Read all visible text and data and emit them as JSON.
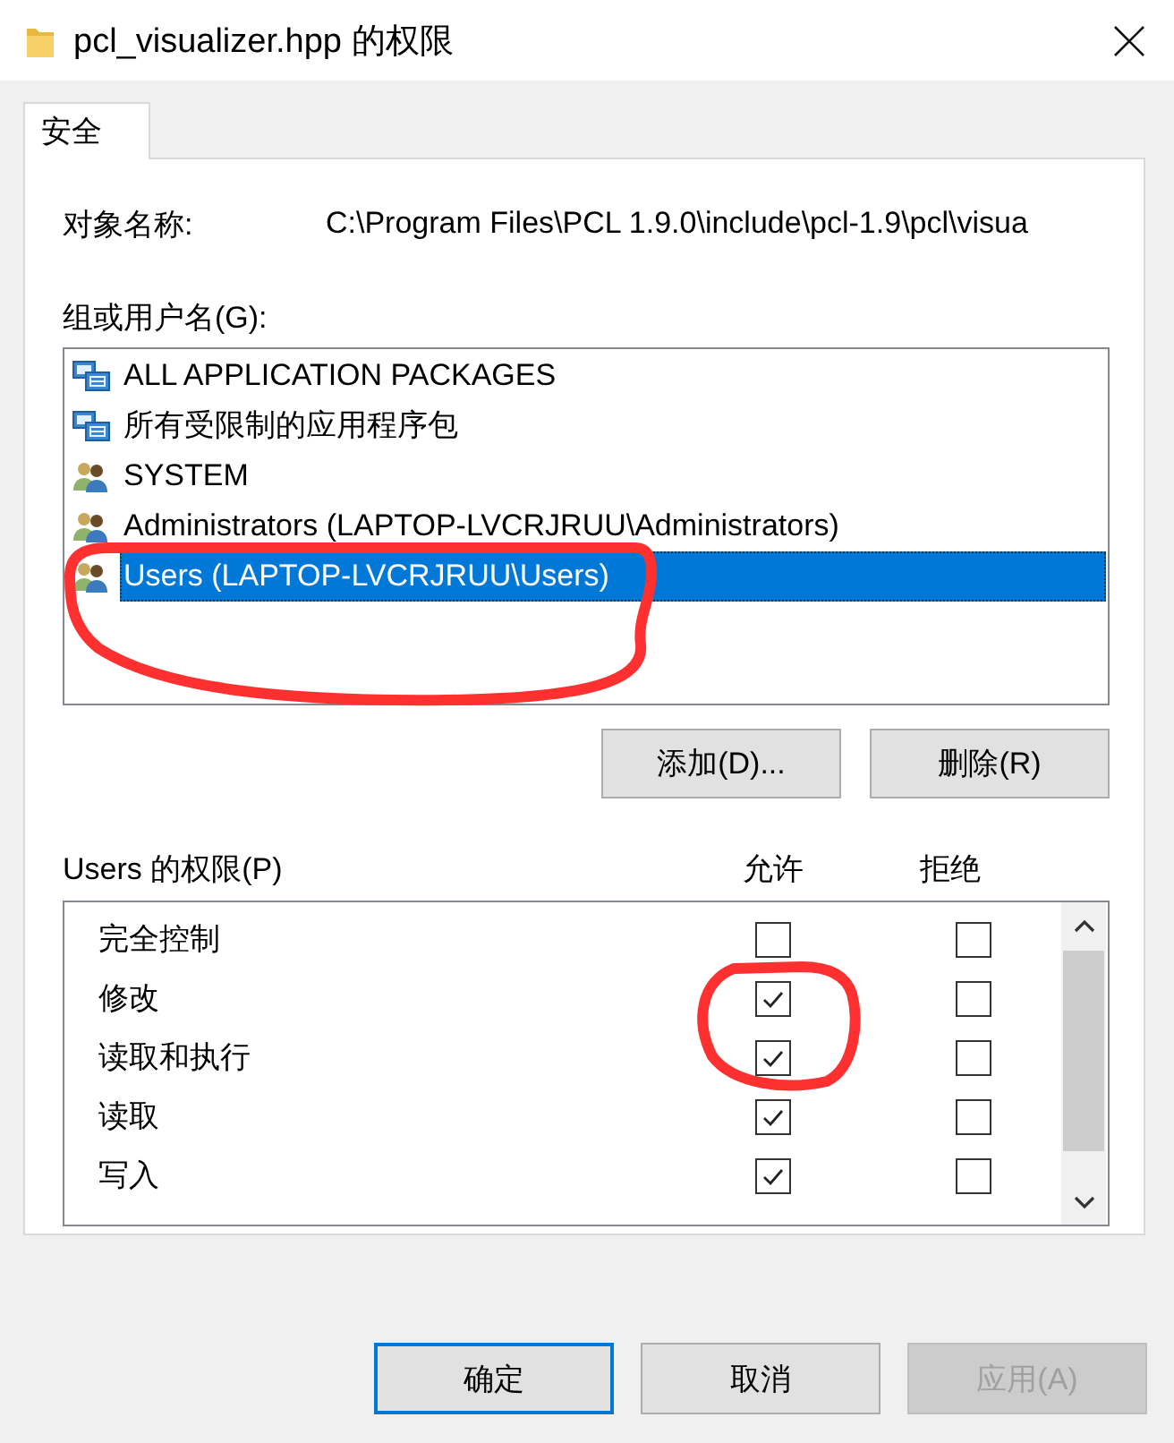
{
  "window": {
    "title": "pcl_visualizer.hpp 的权限"
  },
  "tabs": [
    {
      "label": "安全",
      "selected": true
    }
  ],
  "object_name": {
    "label": "对象名称:",
    "value": "C:\\Program Files\\PCL 1.9.0\\include\\pcl-1.9\\pcl\\visua"
  },
  "groups": {
    "label": "组或用户名(G):",
    "items": [
      {
        "name": "ALL APPLICATION PACKAGES",
        "kind": "package",
        "selected": false
      },
      {
        "name": "所有受限制的应用程序包",
        "kind": "package",
        "selected": false
      },
      {
        "name": "SYSTEM",
        "kind": "users",
        "selected": false
      },
      {
        "name": "Administrators (LAPTOP-LVCRJRUU\\Administrators)",
        "kind": "users",
        "selected": false
      },
      {
        "name": "Users (LAPTOP-LVCRJRUU\\Users)",
        "kind": "users",
        "selected": true
      }
    ]
  },
  "group_buttons": [
    "添加(D)...",
    "删除(R)"
  ],
  "permissions": {
    "label": "Users 的权限(P)",
    "columns": [
      "允许",
      "拒绝"
    ],
    "rows": [
      {
        "name": "完全控制",
        "allow": false,
        "deny": false
      },
      {
        "name": "修改",
        "allow": true,
        "deny": false
      },
      {
        "name": "读取和执行",
        "allow": true,
        "deny": false
      },
      {
        "name": "读取",
        "allow": true,
        "deny": false
      },
      {
        "name": "写入",
        "allow": true,
        "deny": false
      }
    ]
  },
  "buttons": [
    {
      "label": "确定",
      "default": true,
      "disabled": false
    },
    {
      "label": "取消",
      "default": false,
      "disabled": false
    },
    {
      "label": "应用(A)",
      "default": false,
      "disabled": true
    }
  ],
  "annotations": [
    {
      "kind": "scribble"
    },
    {
      "kind": "scribble"
    }
  ]
}
